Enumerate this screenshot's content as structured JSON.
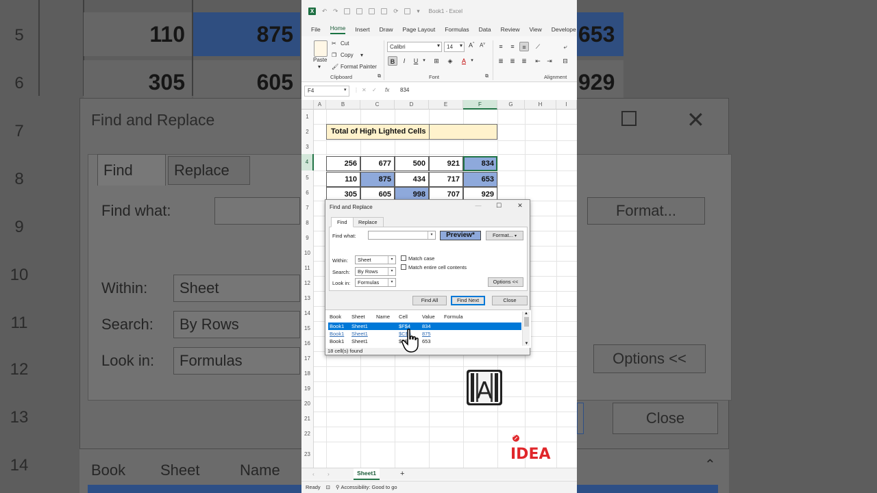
{
  "background": {
    "row_numbers": [
      "5",
      "6",
      "7",
      "8",
      "9",
      "10",
      "11",
      "12",
      "13",
      "14"
    ],
    "cells_row5": [
      "110",
      "875",
      "653"
    ],
    "cells_row6": [
      "305",
      "605",
      "929"
    ],
    "dialog_title": "Find and Replace",
    "tabs": [
      "Find",
      "Replace"
    ],
    "find_what_label": "Find what:",
    "format_button": "Format...",
    "within_label": "Within:",
    "within_value": "Sheet",
    "search_label": "Search:",
    "search_value": "By Rows",
    "lookin_label": "Look in:",
    "lookin_value": "Formulas",
    "options_button": "Options <<",
    "close_button": "Close",
    "results_headers": [
      "Book",
      "Sheet",
      "Name"
    ]
  },
  "excel": {
    "window_title": "Book1 - Excel",
    "menu": [
      "File",
      "Home",
      "Insert",
      "Draw",
      "Page Layout",
      "Formulas",
      "Data",
      "Review",
      "View",
      "Develope"
    ],
    "active_menu": "Home",
    "ribbon": {
      "paste_label": "Paste",
      "cut_label": "Cut",
      "copy_label": "Copy",
      "format_painter_label": "Format Painter",
      "clipboard_group": "Clipboard",
      "font_name": "Calibri",
      "font_size": "14",
      "font_group": "Font",
      "alignment_group": "Alignment"
    },
    "name_box": "F4",
    "formula_value": "834",
    "fx_label": "fx",
    "columns": [
      "A",
      "B",
      "C",
      "D",
      "E",
      "F",
      "G",
      "H",
      "I"
    ],
    "rows": [
      "1",
      "2",
      "3",
      "4",
      "5",
      "6",
      "7",
      "8",
      "9",
      "10",
      "11",
      "12",
      "13",
      "14",
      "15",
      "16",
      "17",
      "18",
      "19",
      "20",
      "21",
      "22",
      "23"
    ],
    "title_cell": "Total of High Lighted Cells",
    "table": [
      [
        "256",
        "677",
        "500",
        "921",
        "834"
      ],
      [
        "110",
        "875",
        "434",
        "717",
        "653"
      ],
      [
        "305",
        "605",
        "998",
        "707",
        "929"
      ]
    ],
    "sheet_tab": "Sheet1",
    "add_sheet": "+",
    "status_ready": "Ready",
    "status_accessibility": "Accessibility: Good to go"
  },
  "find_replace": {
    "title": "Find and Replace",
    "tab_find": "Find",
    "tab_replace": "Replace",
    "find_what_label": "Find what:",
    "find_what_value": "",
    "preview": "Preview*",
    "format_button": "Format...",
    "within_label": "Within:",
    "within_value": "Sheet",
    "search_label": "Search:",
    "search_value": "By Rows",
    "lookin_label": "Look in:",
    "lookin_value": "Formulas",
    "match_case": "Match case",
    "match_entire": "Match entire cell contents",
    "options_button": "Options <<",
    "find_all": "Find All",
    "find_next": "Find Next",
    "close": "Close",
    "results_headers": [
      "Book",
      "Sheet",
      "Name",
      "Cell",
      "Value",
      "Formula"
    ],
    "results": [
      {
        "book": "Book1",
        "sheet": "Sheet1",
        "cell": "$F$4",
        "value": "834"
      },
      {
        "book": "Book1",
        "sheet": "Sheet1",
        "cell": "$C$5",
        "value": "875"
      },
      {
        "book": "Book1",
        "sheet": "Sheet1",
        "cell": "$F$5",
        "value": "653"
      }
    ],
    "found_count": "18 cell(s) found"
  },
  "colors": {
    "highlight": "#8ea9db",
    "title_fill": "#fff2cc",
    "excel_green": "#217346",
    "selection_blue": "#0078d7",
    "logo_red": "#e0262a"
  },
  "logos": {
    "idea_text": "IDEA",
    "a_letter": "A"
  }
}
